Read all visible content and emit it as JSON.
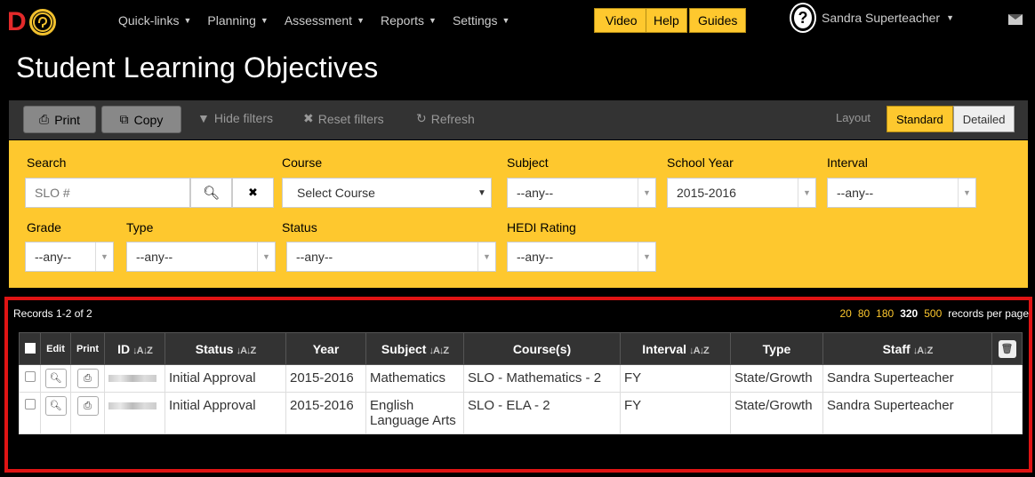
{
  "nav": {
    "logo_letter": "D",
    "items": [
      {
        "label": "Quick-links"
      },
      {
        "label": "Planning"
      },
      {
        "label": "Assessment"
      },
      {
        "label": "Reports"
      },
      {
        "label": "Settings"
      }
    ],
    "gold_buttons": [
      "Video",
      "Help",
      "Guides"
    ],
    "user_name": "Sandra Superteacher",
    "avatar_glyph": "?",
    "icons": [
      "lightbulb-icon",
      "caret-down-icon",
      "envelope-icon"
    ]
  },
  "page_title": "Student Learning Objectives",
  "toolbar": {
    "print_label": "Print",
    "copy_label": "Copy",
    "hide_filters_label": "Hide filters",
    "reset_filters_label": "Reset filters",
    "refresh_label": "Refresh",
    "layout_label": "Layout",
    "layout_standard": "Standard",
    "layout_detailed": "Detailed",
    "layout_selected": "Standard"
  },
  "filters": {
    "search_label": "Search",
    "search_placeholder": "SLO #",
    "course_label": "Course",
    "course_value": "Select Course",
    "subject_label": "Subject",
    "subject_value": "--any--",
    "school_year_label": "School Year",
    "school_year_value": "2015-2016",
    "interval_label": "Interval",
    "interval_value": "--any--",
    "grade_label": "Grade",
    "grade_value": "--any--",
    "type_label": "Type",
    "type_value": "--any--",
    "status_label": "Status",
    "status_value": "--any--",
    "hedi_label": "HEDI Rating",
    "hedi_value": "--any--"
  },
  "records": {
    "count_text": "Records 1-2 of 2",
    "per_page_options": [
      "20",
      "80",
      "180",
      "320",
      "500"
    ],
    "per_page_selected": "320",
    "per_page_suffix": "records per page",
    "columns": {
      "edit": "Edit",
      "print": "Print",
      "id": "ID",
      "status": "Status",
      "year": "Year",
      "subject": "Subject",
      "courses": "Course(s)",
      "interval": "Interval",
      "type": "Type",
      "staff": "Staff"
    },
    "rows": [
      {
        "status": "Initial Approval",
        "year": "2015-2016",
        "subject": "Mathematics",
        "course": "SLO - Mathematics - 2",
        "interval": "FY",
        "type": "State/Growth",
        "staff": "Sandra Superteacher"
      },
      {
        "status": "Initial Approval",
        "year": "2015-2016",
        "subject": "English Language Arts",
        "course": "SLO - ELA - 2",
        "interval": "FY",
        "type": "State/Growth",
        "staff": "Sandra Superteacher"
      }
    ]
  },
  "colors": {
    "accent_gold": "#fec82e",
    "highlight_red": "#e01414",
    "logo_red": "#e32a2a"
  }
}
